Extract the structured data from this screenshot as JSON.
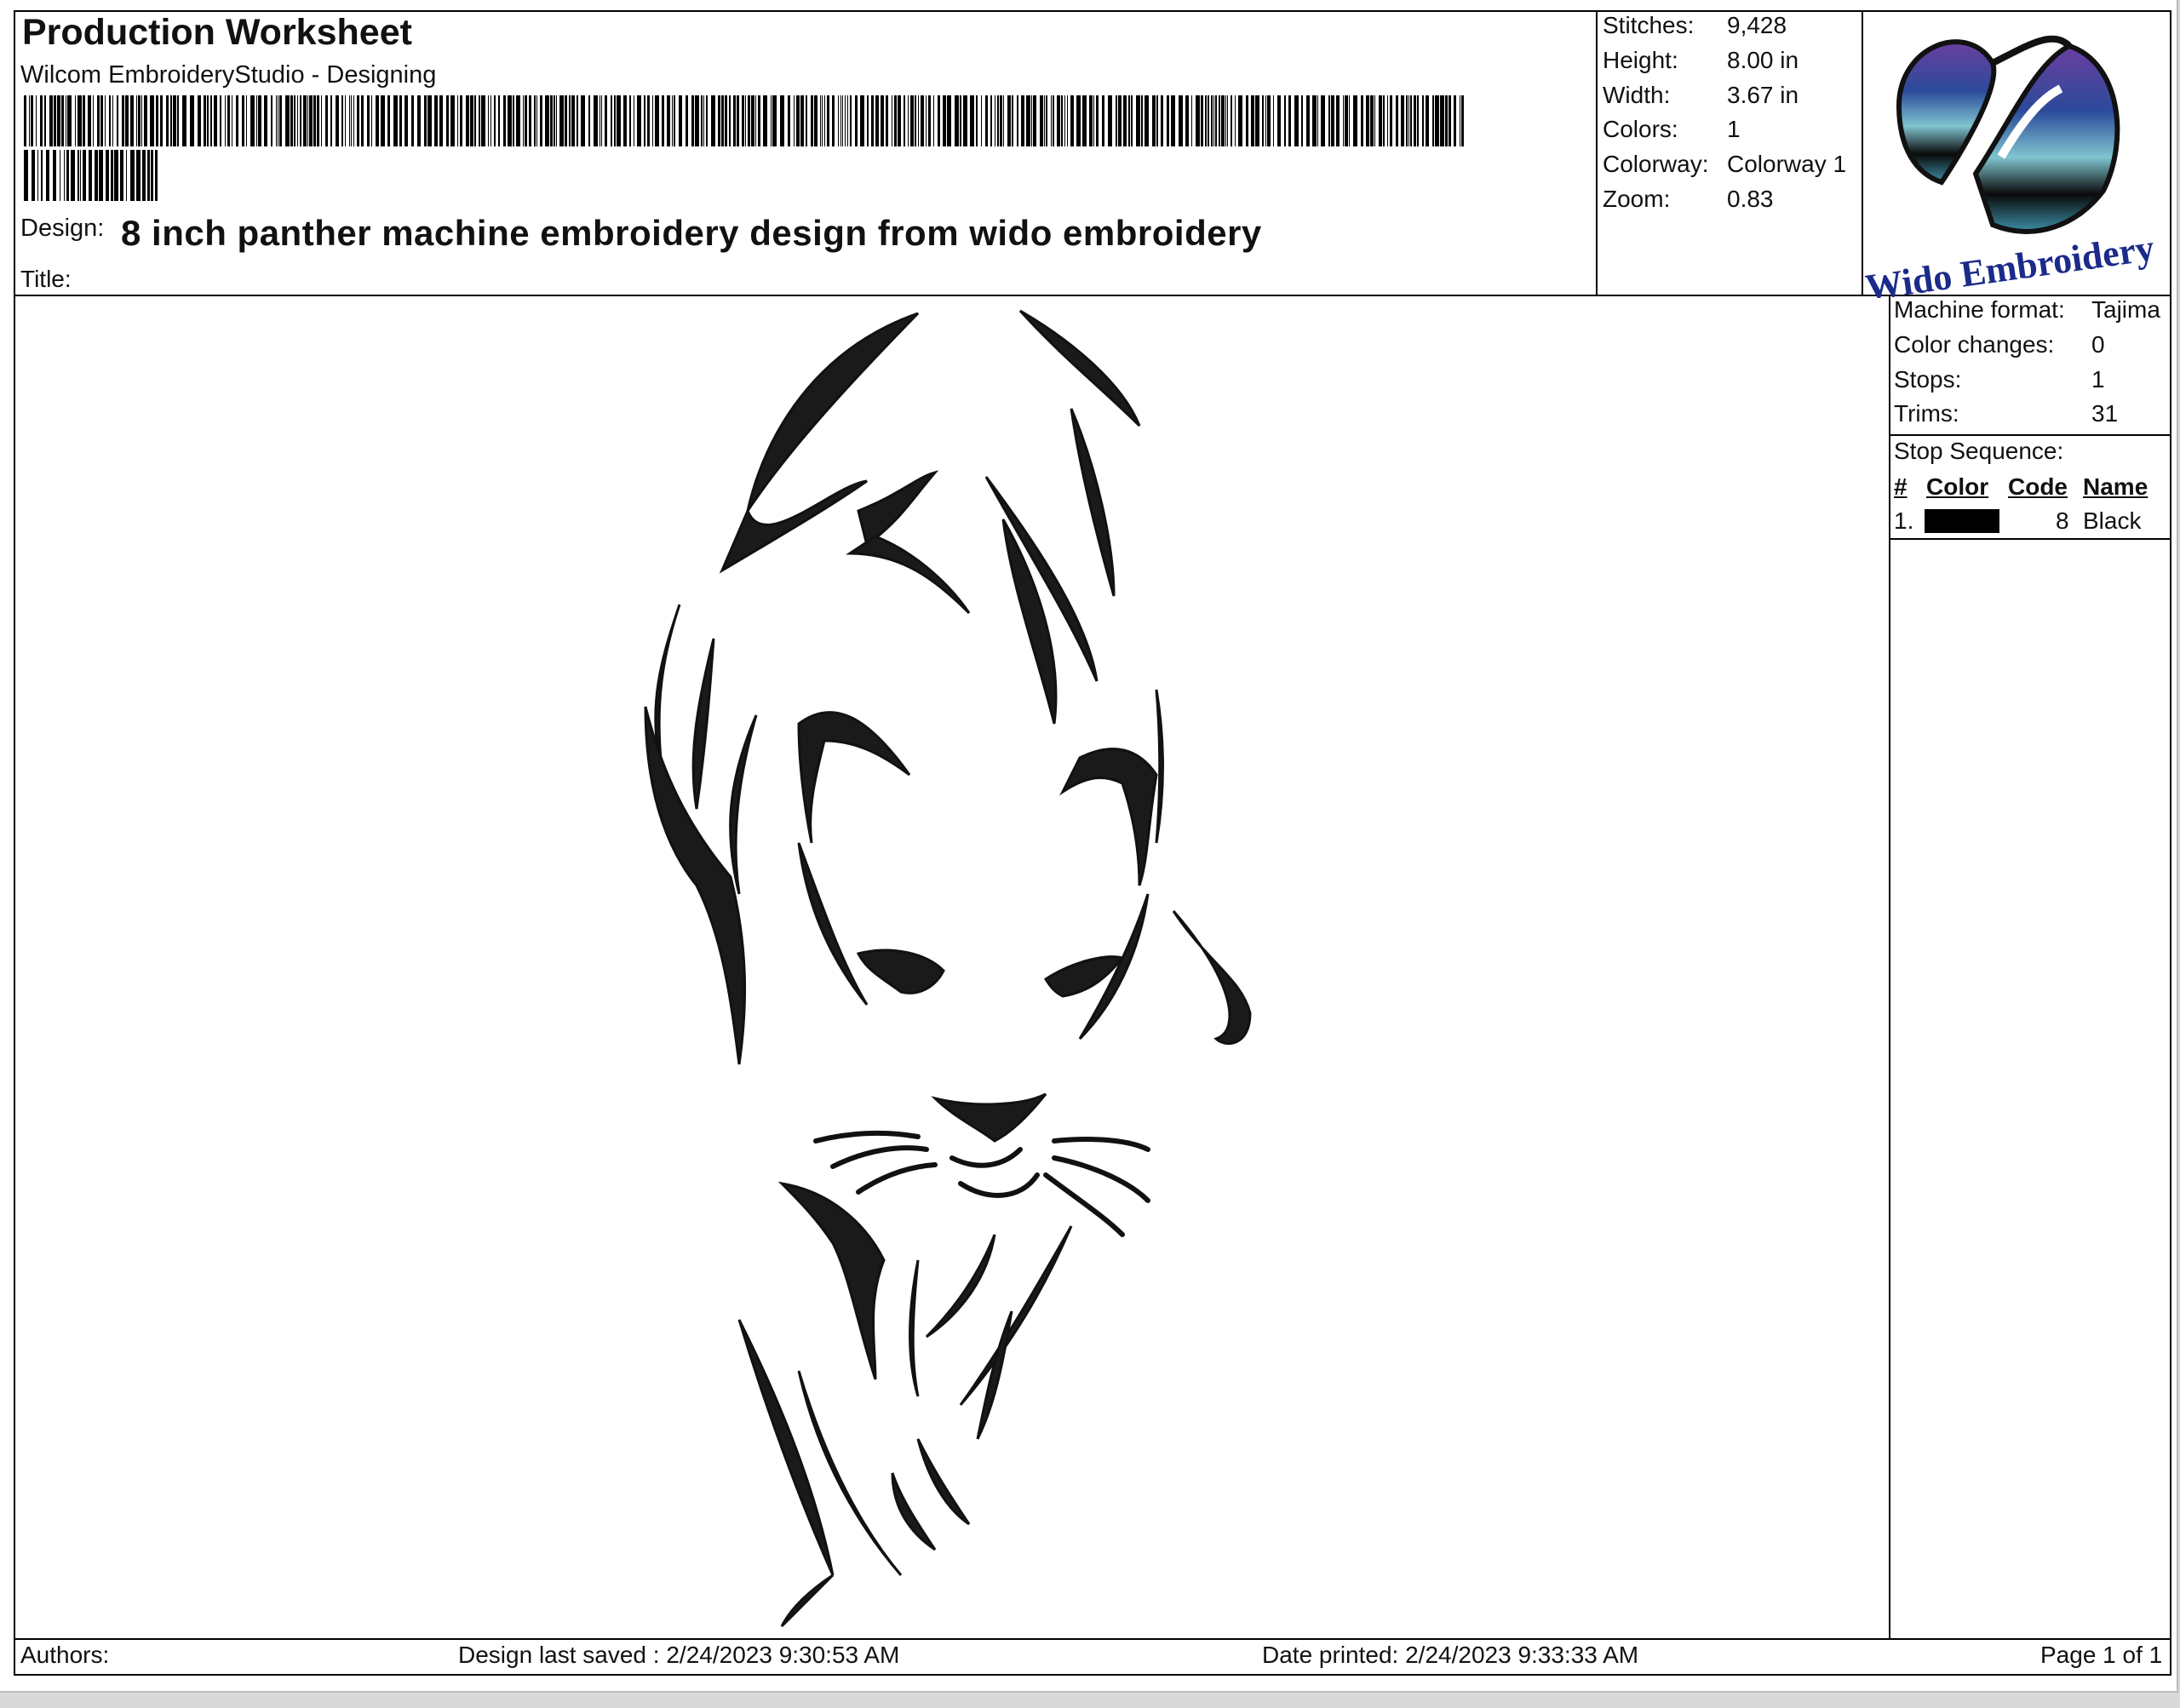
{
  "header": {
    "title": "Production Worksheet",
    "subtitle": "Wilcom EmbroideryStudio - Designing",
    "design_label": "Design:",
    "design_name": "8 inch panther machine embroidery design from wido embroidery",
    "title_label": "Title:"
  },
  "stats": [
    {
      "label": "Stitches:",
      "value": "9,428"
    },
    {
      "label": "Height:",
      "value": "8.00 in"
    },
    {
      "label": "Width:",
      "value": "3.67 in"
    },
    {
      "label": "Colors:",
      "value": "1"
    },
    {
      "label": "Colorway:",
      "value": "Colorway 1"
    },
    {
      "label": "Zoom:",
      "value": "0.83"
    }
  ],
  "logo": {
    "text": "Wido Embroidery",
    "colors": [
      "#1c2a8a",
      "#5aa7b8",
      "#000000"
    ]
  },
  "machine": [
    {
      "label": "Machine format:",
      "value": "Tajima"
    },
    {
      "label": "Color changes:",
      "value": "0"
    },
    {
      "label": "Stops:",
      "value": "1"
    },
    {
      "label": "Trims:",
      "value": "31"
    }
  ],
  "stop_sequence": {
    "label": "Stop Sequence:",
    "columns": [
      "#",
      "Color",
      "Code",
      "Name"
    ],
    "rows": [
      {
        "num": "1.",
        "color": "#000000",
        "code": "8",
        "name": "Black"
      }
    ]
  },
  "footer": {
    "authors": "Authors:",
    "last_saved": "Design last saved : 2/24/2023 9:30:53 AM",
    "printed": "Date printed: 2/24/2023 9:33:33 AM",
    "page": "Page 1 of 1"
  }
}
